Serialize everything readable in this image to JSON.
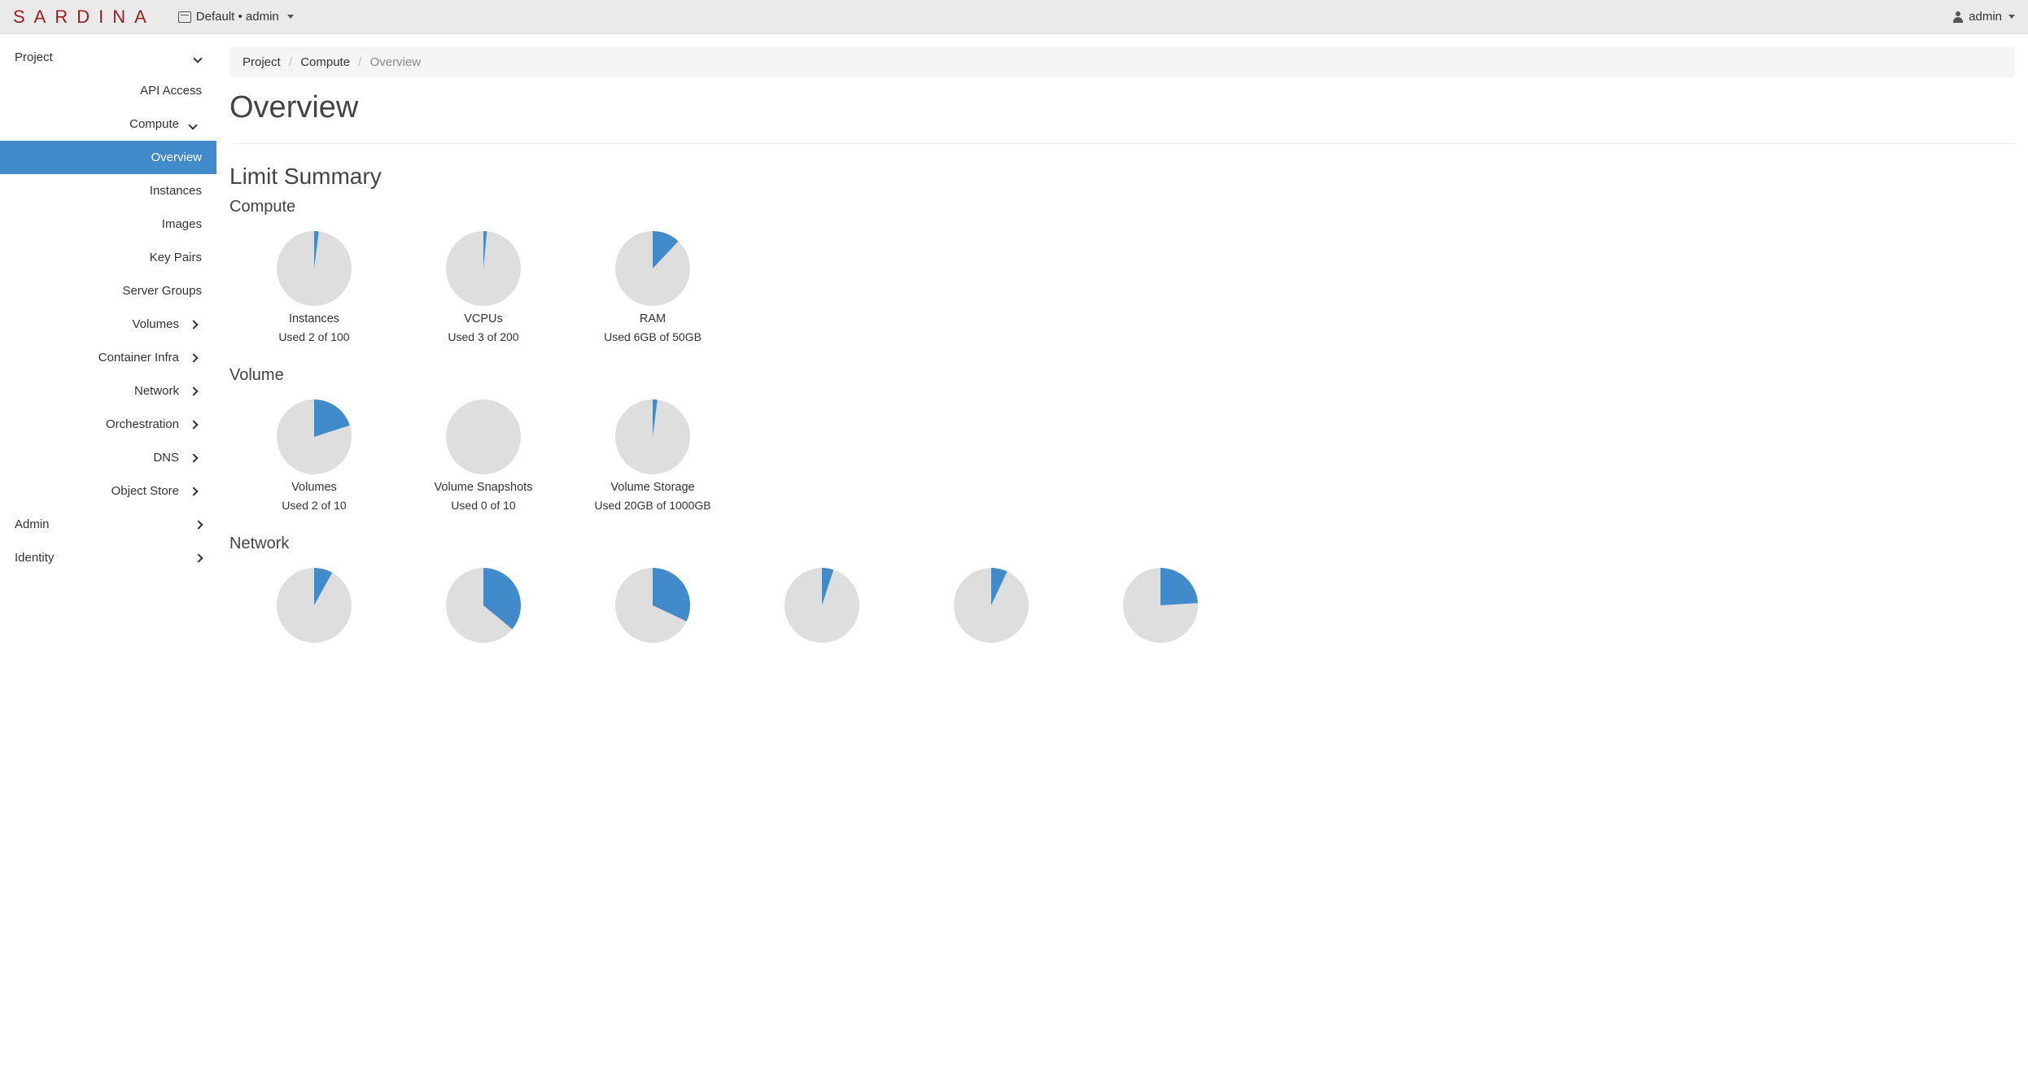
{
  "topbar": {
    "brand": "SARDINA",
    "domain_project": "Default • admin",
    "user": "admin"
  },
  "sidebar": {
    "items": [
      {
        "label": "Project",
        "expanded": true,
        "children": [
          {
            "label": "API Access",
            "kind": "link"
          },
          {
            "label": "Compute",
            "kind": "group",
            "expanded": true,
            "children": [
              {
                "label": "Overview",
                "active": true
              },
              {
                "label": "Instances"
              },
              {
                "label": "Images"
              },
              {
                "label": "Key Pairs"
              },
              {
                "label": "Server Groups"
              }
            ]
          },
          {
            "label": "Volumes",
            "kind": "group",
            "expanded": false
          },
          {
            "label": "Container Infra",
            "kind": "group",
            "expanded": false
          },
          {
            "label": "Network",
            "kind": "group",
            "expanded": false
          },
          {
            "label": "Orchestration",
            "kind": "group",
            "expanded": false
          },
          {
            "label": "DNS",
            "kind": "group",
            "expanded": false
          },
          {
            "label": "Object Store",
            "kind": "group",
            "expanded": false
          }
        ]
      },
      {
        "label": "Admin",
        "expanded": false
      },
      {
        "label": "Identity",
        "expanded": false
      }
    ]
  },
  "breadcrumb": {
    "items": [
      "Project",
      "Compute",
      "Overview"
    ]
  },
  "page": {
    "title": "Overview",
    "limit_summary_heading": "Limit Summary",
    "groups": {
      "compute": {
        "heading": "Compute",
        "charts": [
          {
            "label": "Instances",
            "usage": "Used 2 of 100",
            "used": 2,
            "max": 100
          },
          {
            "label": "VCPUs",
            "usage": "Used 3 of 200",
            "used": 3,
            "max": 200
          },
          {
            "label": "RAM",
            "usage": "Used 6GB of 50GB",
            "used": 6,
            "max": 50
          }
        ]
      },
      "volume": {
        "heading": "Volume",
        "charts": [
          {
            "label": "Volumes",
            "usage": "Used 2 of 10",
            "used": 2,
            "max": 10
          },
          {
            "label": "Volume Snapshots",
            "usage": "Used 0 of 10",
            "used": 0,
            "max": 10
          },
          {
            "label": "Volume Storage",
            "usage": "Used 20GB of 1000GB",
            "used": 20,
            "max": 1000
          }
        ]
      },
      "network": {
        "heading": "Network",
        "charts": [
          {
            "label": "",
            "usage": "",
            "used": 8,
            "max": 100
          },
          {
            "label": "",
            "usage": "",
            "used": 36,
            "max": 100
          },
          {
            "label": "",
            "usage": "",
            "used": 32,
            "max": 100
          },
          {
            "label": "",
            "usage": "",
            "used": 5,
            "max": 100
          },
          {
            "label": "",
            "usage": "",
            "used": 7,
            "max": 100
          },
          {
            "label": "",
            "usage": "",
            "used": 24,
            "max": 100
          }
        ]
      }
    }
  },
  "colors": {
    "used": "#428bca",
    "free": "#dedede"
  },
  "chart_data": [
    {
      "type": "pie",
      "title": "Instances",
      "series": [
        {
          "name": "Used",
          "value": 2
        },
        {
          "name": "Free",
          "value": 98
        }
      ],
      "total": 100
    },
    {
      "type": "pie",
      "title": "VCPUs",
      "series": [
        {
          "name": "Used",
          "value": 3
        },
        {
          "name": "Free",
          "value": 197
        }
      ],
      "total": 200
    },
    {
      "type": "pie",
      "title": "RAM (GB)",
      "series": [
        {
          "name": "Used",
          "value": 6
        },
        {
          "name": "Free",
          "value": 44
        }
      ],
      "total": 50
    },
    {
      "type": "pie",
      "title": "Volumes",
      "series": [
        {
          "name": "Used",
          "value": 2
        },
        {
          "name": "Free",
          "value": 8
        }
      ],
      "total": 10
    },
    {
      "type": "pie",
      "title": "Volume Snapshots",
      "series": [
        {
          "name": "Used",
          "value": 0
        },
        {
          "name": "Free",
          "value": 10
        }
      ],
      "total": 10
    },
    {
      "type": "pie",
      "title": "Volume Storage (GB)",
      "series": [
        {
          "name": "Used",
          "value": 20
        },
        {
          "name": "Free",
          "value": 980
        }
      ],
      "total": 1000
    }
  ]
}
